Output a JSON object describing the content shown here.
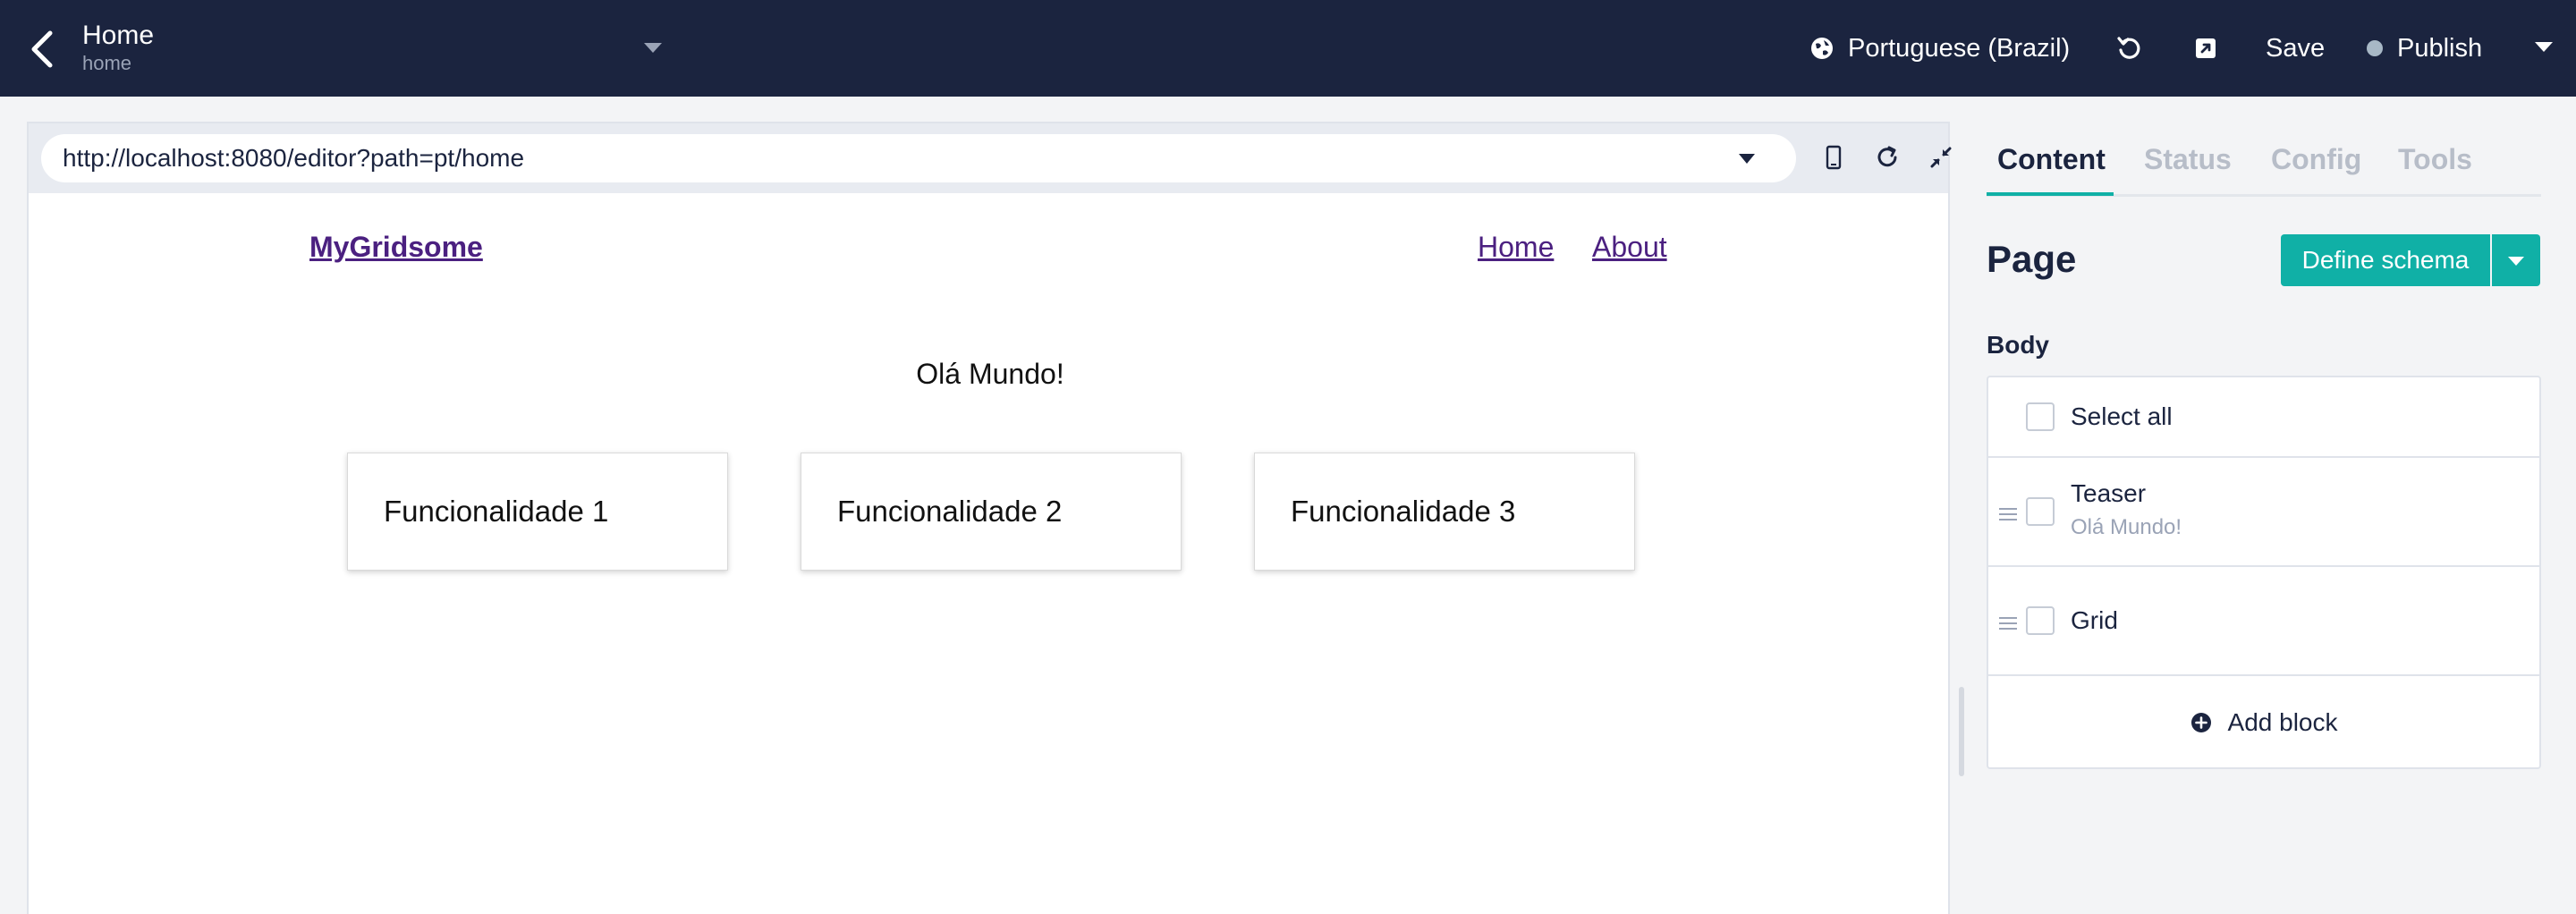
{
  "header": {
    "title": "Home",
    "subtitle": "home",
    "locale": "Portuguese (Brazil)",
    "save_label": "Save",
    "publish_label": "Publish"
  },
  "browser": {
    "url": "http://localhost:8080/editor?path=pt/home"
  },
  "site": {
    "brand": "MyGridsome",
    "nav": [
      "Home",
      "About"
    ],
    "heading": "Olá Mundo!",
    "features": [
      "Funcionalidade 1",
      "Funcionalidade 2",
      "Funcionalidade 3"
    ]
  },
  "sidebar": {
    "tabs": [
      "Content",
      "Status",
      "Config",
      "Tools"
    ],
    "active_tab": "Content",
    "page_heading": "Page",
    "define_schema_label": "Define schema",
    "body_label": "Body",
    "select_all_label": "Select all",
    "blocks": [
      {
        "label": "Teaser",
        "summary": "Olá Mundo!"
      },
      {
        "label": "Grid",
        "summary": ""
      }
    ],
    "add_block_label": "Add block"
  },
  "colors": {
    "header_bg": "#1b243f",
    "accent": "#10b0a6",
    "link": "#4b2080"
  }
}
